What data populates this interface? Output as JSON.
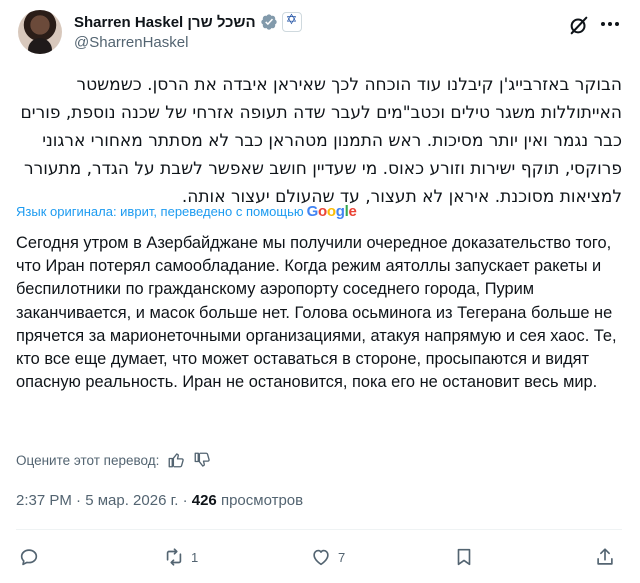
{
  "author": {
    "display_name": "Sharren Haskel השכל שרן",
    "handle": "@SharrenHaskel"
  },
  "tweet": {
    "original_text": "הבוקר באזרבייג'ן קיבלנו עוד הוכחה לכך שאיראן איבדה את הרסן. כשמשטר האייתוללות משגר טילים וכטב\"מים לעבר שדה תעופה אזרחי של שכנה נוספת, פורים כבר נגמר ואין יותר מסיכות. ראש התמנון מטהראן כבר לא מסתתר מאחורי ארגוני פרוקסי, תוקף ישירות וזורע כאוס. מי שעדיין חושב שאפשר לשבת על הגדר, מתעורר למציאות מסוכנת. איראן לא תעצור, עד שהעולם יעצור אותה.",
    "translated_note": "Язык оригинала: иврит, переведено с помощью",
    "google_logo": "Google",
    "translated_text": "Сегодня утром в Азербайджане мы получили очередное доказательство того, что Иран потерял самообладание. Когда режим аятоллы запускает ракеты и беспилотники по гражданскому аэропорту соседнего города, Пурим заканчивается, и масок больше нет. Голова осьминога из Тегерана больше не прячется за марионеточными организациями, атакуя напрямую и сея хаос. Те, кто все еще думает, что может оставаться в стороне, просыпаются и видят опасную реальность. Иран не остановится, пока его не остановит весь мир.",
    "rate_translation": "Оцените этот перевод:",
    "time": "2:37 PM",
    "date": "5 мар. 2026 г.",
    "views_count": "426",
    "views_label": "просмотров"
  },
  "actions": {
    "replies": "",
    "reposts": "1",
    "likes": "7"
  },
  "colors": {
    "link": "#1d9bf0",
    "secondary_text": "#536471",
    "verified": "#829aab"
  }
}
